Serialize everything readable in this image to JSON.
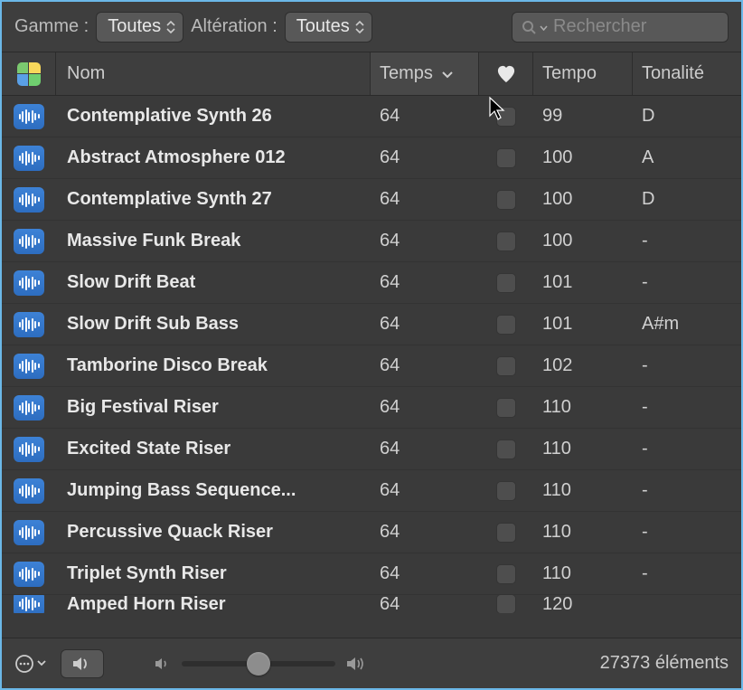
{
  "toolbar": {
    "gamme_label": "Gamme :",
    "gamme_value": "Toutes",
    "alteration_label": "Altération :",
    "alteration_value": "Toutes",
    "search_placeholder": "Rechercher"
  },
  "columns": {
    "name": "Nom",
    "temps": "Temps",
    "tempo": "Tempo",
    "key": "Tonalité"
  },
  "rows": [
    {
      "name": "Contemplative Synth 26",
      "temps": "64",
      "tempo": "99",
      "key": "D"
    },
    {
      "name": "Abstract Atmosphere 012",
      "temps": "64",
      "tempo": "100",
      "key": "A"
    },
    {
      "name": "Contemplative Synth 27",
      "temps": "64",
      "tempo": "100",
      "key": "D"
    },
    {
      "name": "Massive Funk Break",
      "temps": "64",
      "tempo": "100",
      "key": "-"
    },
    {
      "name": "Slow Drift Beat",
      "temps": "64",
      "tempo": "101",
      "key": "-"
    },
    {
      "name": "Slow Drift Sub Bass",
      "temps": "64",
      "tempo": "101",
      "key": "A#m"
    },
    {
      "name": "Tamborine Disco Break",
      "temps": "64",
      "tempo": "102",
      "key": "-"
    },
    {
      "name": "Big Festival Riser",
      "temps": "64",
      "tempo": "110",
      "key": "-"
    },
    {
      "name": "Excited State Riser",
      "temps": "64",
      "tempo": "110",
      "key": "-"
    },
    {
      "name": "Jumping Bass Sequence...",
      "temps": "64",
      "tempo": "110",
      "key": "-"
    },
    {
      "name": "Percussive Quack Riser",
      "temps": "64",
      "tempo": "110",
      "key": "-"
    },
    {
      "name": "Triplet Synth Riser",
      "temps": "64",
      "tempo": "110",
      "key": "-"
    },
    {
      "name": "Amped Horn Riser",
      "temps": "64",
      "tempo": "120",
      "key": ""
    }
  ],
  "footer": {
    "count_text": "27373 éléments"
  }
}
